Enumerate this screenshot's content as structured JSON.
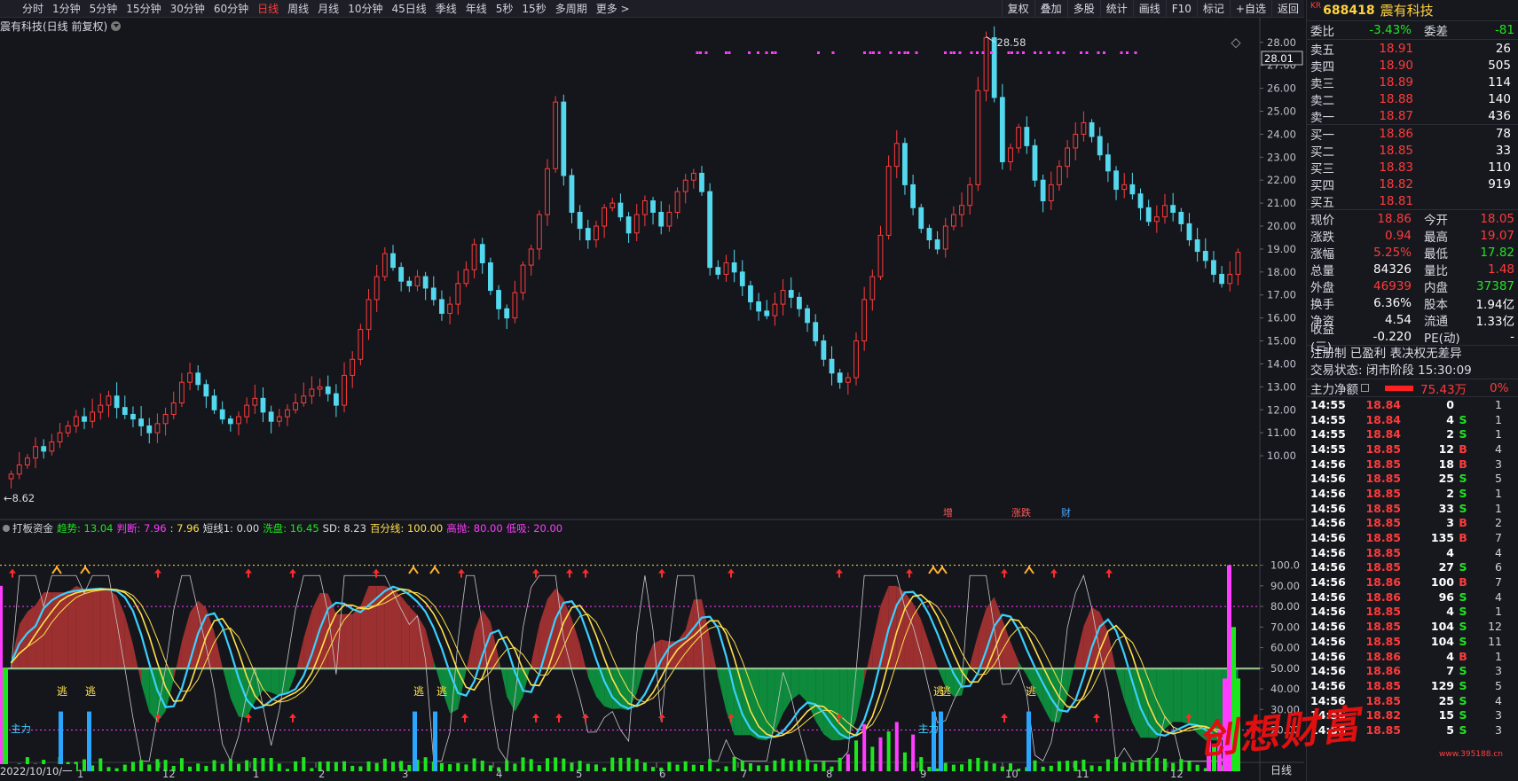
{
  "toolbar": {
    "tabs": [
      "分时",
      "1分钟",
      "5分钟",
      "15分钟",
      "30分钟",
      "60分钟",
      "日线",
      "周线",
      "月线",
      "10分钟",
      "45日线",
      "季线",
      "年线",
      "5秒",
      "15秒",
      "多周期",
      "更多 >"
    ],
    "active_tab": "日线",
    "right_buttons": [
      "复权",
      "叠加",
      "多股",
      "统计",
      "画线",
      "F10",
      "标记",
      "+自选",
      "返回"
    ]
  },
  "stock_title": "震有科技(日线 前复权)",
  "price_chart": {
    "y_ticks": [
      "10.00",
      "11.00",
      "12.00",
      "13.00",
      "14.00",
      "15.00",
      "16.00",
      "17.00",
      "18.00",
      "19.00",
      "20.00",
      "21.00",
      "22.00",
      "23.00",
      "24.00",
      "25.00",
      "26.00",
      "27.00",
      "28.00"
    ],
    "y_min": 9.0,
    "y_max": 28.3,
    "high_label": "28.58",
    "low_label": "8.62",
    "current_tag": "28.01",
    "series": [
      9.2,
      9.6,
      9.9,
      10.4,
      10.2,
      10.6,
      11.0,
      11.3,
      11.7,
      11.5,
      11.9,
      12.2,
      12.6,
      12.1,
      11.8,
      11.6,
      11.3,
      11.0,
      11.4,
      11.8,
      12.3,
      13.2,
      13.6,
      13.1,
      12.6,
      12.0,
      11.6,
      11.4,
      11.7,
      12.2,
      12.5,
      11.9,
      11.5,
      11.7,
      12.0,
      12.3,
      12.6,
      12.9,
      13.0,
      12.7,
      12.2,
      13.5,
      14.2,
      15.5,
      16.8,
      17.8,
      18.8,
      18.2,
      17.6,
      17.4,
      17.8,
      17.3,
      16.8,
      16.2,
      16.6,
      17.5,
      18.1,
      19.2,
      18.4,
      17.2,
      16.4,
      16.0,
      17.1,
      18.3,
      19.0,
      20.5,
      22.5,
      25.4,
      22.2,
      20.6,
      19.9,
      19.4,
      20.0,
      20.8,
      21.0,
      20.4,
      19.7,
      20.5,
      21.1,
      20.6,
      20.0,
      20.6,
      21.5,
      22.0,
      22.3,
      21.5,
      18.2,
      17.9,
      18.4,
      18.0,
      17.4,
      16.7,
      16.3,
      16.1,
      16.6,
      17.2,
      16.9,
      16.4,
      15.8,
      15.0,
      14.2,
      13.6,
      13.2,
      13.4,
      15.0,
      16.8,
      17.8,
      19.6,
      22.6,
      23.6,
      21.8,
      20.8,
      19.9,
      19.4,
      19.0,
      20.0,
      20.5,
      20.9,
      21.8,
      25.9,
      28.2,
      25.6,
      22.8,
      23.4,
      24.3,
      23.5,
      22.0,
      21.1,
      21.8,
      22.6,
      23.4,
      24.0,
      24.5,
      23.9,
      23.1,
      22.4,
      21.6,
      21.8,
      21.4,
      20.8,
      20.2,
      20.4,
      20.9,
      20.6,
      20.1,
      19.4,
      18.9,
      18.5,
      17.9,
      17.5,
      17.9,
      18.86
    ],
    "top_markers": "purple dotted signals"
  },
  "indicator": {
    "name": "打板资金",
    "params": [
      {
        "label": "趋势: 13.04",
        "color": "#1ee61e"
      },
      {
        "label": "判断: 7.96",
        "color": "#ff3cff"
      },
      {
        "label": ": 7.96",
        "color": "#ffe14a"
      },
      {
        "label": "短线1: 0.00",
        "color": "#d8dce4"
      },
      {
        "label": "洗盘: 16.45",
        "color": "#1ee61e"
      },
      {
        "label": "SD: 8.23",
        "color": "#d8dce4"
      },
      {
        "label": "百分线: 100.00",
        "color": "#ffe14a"
      },
      {
        "label": "高抛: 80.00",
        "color": "#ff3cff"
      },
      {
        "label": "低吸: 20.00",
        "color": "#ff3cff"
      }
    ],
    "y_ticks": [
      "20.00",
      "30.00",
      "40.00",
      "50.00",
      "60.00",
      "70.00",
      "80.00",
      "90.00",
      "100.0"
    ],
    "escape_label": "逃",
    "main_label": "主力",
    "event_labels": [
      "增",
      "涨跌",
      "财"
    ]
  },
  "x_axis": {
    "date_label": "2022/10/10/一",
    "months": [
      "1",
      "12",
      "1",
      "2",
      "3",
      "4",
      "5",
      "6",
      "7",
      "8",
      "9",
      "10",
      "11",
      "12"
    ],
    "period_label": "日线"
  },
  "quote": {
    "kr": "KR",
    "code": "688418",
    "name": "震有科技",
    "weibi_label": "委比",
    "weibi": "-3.43%",
    "weicha_label": "委差",
    "weicha": "-81",
    "asks": [
      {
        "label": "卖五",
        "price": "18.91",
        "vol": "26"
      },
      {
        "label": "卖四",
        "price": "18.90",
        "vol": "505"
      },
      {
        "label": "卖三",
        "price": "18.89",
        "vol": "114"
      },
      {
        "label": "卖二",
        "price": "18.88",
        "vol": "140"
      },
      {
        "label": "卖一",
        "price": "18.87",
        "vol": "436"
      }
    ],
    "bids": [
      {
        "label": "买一",
        "price": "18.86",
        "vol": "78"
      },
      {
        "label": "买二",
        "price": "18.85",
        "vol": "33"
      },
      {
        "label": "买三",
        "price": "18.83",
        "vol": "110"
      },
      {
        "label": "买四",
        "price": "18.82",
        "vol": "919"
      },
      {
        "label": "买五",
        "price": "18.81",
        "vol": ""
      }
    ],
    "stats": [
      {
        "l1": "现价",
        "v1": "18.86",
        "c1": "red",
        "l2": "今开",
        "v2": "18.05",
        "c2": "red"
      },
      {
        "l1": "涨跌",
        "v1": "0.94",
        "c1": "red",
        "l2": "最高",
        "v2": "19.07",
        "c2": "red"
      },
      {
        "l1": "涨幅",
        "v1": "5.25%",
        "c1": "red",
        "l2": "最低",
        "v2": "17.82",
        "c2": "green"
      },
      {
        "l1": "总量",
        "v1": "84326",
        "c1": "white",
        "l2": "量比",
        "v2": "1.48",
        "c2": "red"
      },
      {
        "l1": "外盘",
        "v1": "46939",
        "c1": "red",
        "l2": "内盘",
        "v2": "37387",
        "c2": "green"
      },
      {
        "l1": "换手",
        "v1": "6.36%",
        "c1": "white",
        "l2": "股本",
        "v2": "1.94亿",
        "c2": "white"
      },
      {
        "l1": "净资",
        "v1": "4.54",
        "c1": "white",
        "l2": "流通",
        "v2": "1.33亿",
        "c2": "white"
      },
      {
        "l1": "收益(三)",
        "v1": "-0.220",
        "c1": "white",
        "l2": "PE(动)",
        "v2": "-",
        "c2": "white"
      }
    ],
    "registration": "注册制 已盈利 表决权无差异",
    "trade_status": "交易状态: 闭市阶段 15:30:09",
    "mainforce_label": "主力净额",
    "mainforce_value": "75.43万",
    "mainforce_pct": "0%"
  },
  "ticks": [
    {
      "t": "14:55",
      "p": "18.84",
      "v": "0",
      "bs": "",
      "n": "1"
    },
    {
      "t": "14:55",
      "p": "18.84",
      "v": "4",
      "bs": "S",
      "n": "1"
    },
    {
      "t": "14:55",
      "p": "18.84",
      "v": "2",
      "bs": "S",
      "n": "1"
    },
    {
      "t": "14:55",
      "p": "18.85",
      "v": "12",
      "bs": "B",
      "n": "4"
    },
    {
      "t": "14:56",
      "p": "18.85",
      "v": "18",
      "bs": "B",
      "n": "3"
    },
    {
      "t": "14:56",
      "p": "18.85",
      "v": "25",
      "bs": "S",
      "n": "5"
    },
    {
      "t": "14:56",
      "p": "18.85",
      "v": "2",
      "bs": "S",
      "n": "1"
    },
    {
      "t": "14:56",
      "p": "18.85",
      "v": "33",
      "bs": "S",
      "n": "1"
    },
    {
      "t": "14:56",
      "p": "18.85",
      "v": "3",
      "bs": "B",
      "n": "2"
    },
    {
      "t": "14:56",
      "p": "18.85",
      "v": "135",
      "bs": "B",
      "n": "7"
    },
    {
      "t": "14:56",
      "p": "18.85",
      "v": "4",
      "bs": "",
      "n": "4"
    },
    {
      "t": "14:56",
      "p": "18.85",
      "v": "27",
      "bs": "S",
      "n": "6"
    },
    {
      "t": "14:56",
      "p": "18.86",
      "v": "100",
      "bs": "B",
      "n": "7"
    },
    {
      "t": "14:56",
      "p": "18.86",
      "v": "96",
      "bs": "S",
      "n": "4"
    },
    {
      "t": "14:56",
      "p": "18.85",
      "v": "4",
      "bs": "S",
      "n": "1"
    },
    {
      "t": "14:56",
      "p": "18.85",
      "v": "104",
      "bs": "S",
      "n": "12"
    },
    {
      "t": "14:56",
      "p": "18.85",
      "v": "104",
      "bs": "S",
      "n": "11"
    },
    {
      "t": "14:56",
      "p": "18.86",
      "v": "4",
      "bs": "B",
      "n": "1"
    },
    {
      "t": "14:56",
      "p": "18.86",
      "v": "7",
      "bs": "S",
      "n": "3"
    },
    {
      "t": "14:56",
      "p": "18.85",
      "v": "129",
      "bs": "S",
      "n": "5"
    },
    {
      "t": "14:56",
      "p": "18.85",
      "v": "25",
      "bs": "S",
      "n": "4"
    },
    {
      "t": "14:56",
      "p": "18.82",
      "v": "15",
      "bs": "S",
      "n": "3"
    },
    {
      "t": "14:56",
      "p": "18.85",
      "v": "5",
      "bs": "S",
      "n": "3"
    }
  ],
  "watermark": "创想财富",
  "watermark_url": "www.395188.cn"
}
